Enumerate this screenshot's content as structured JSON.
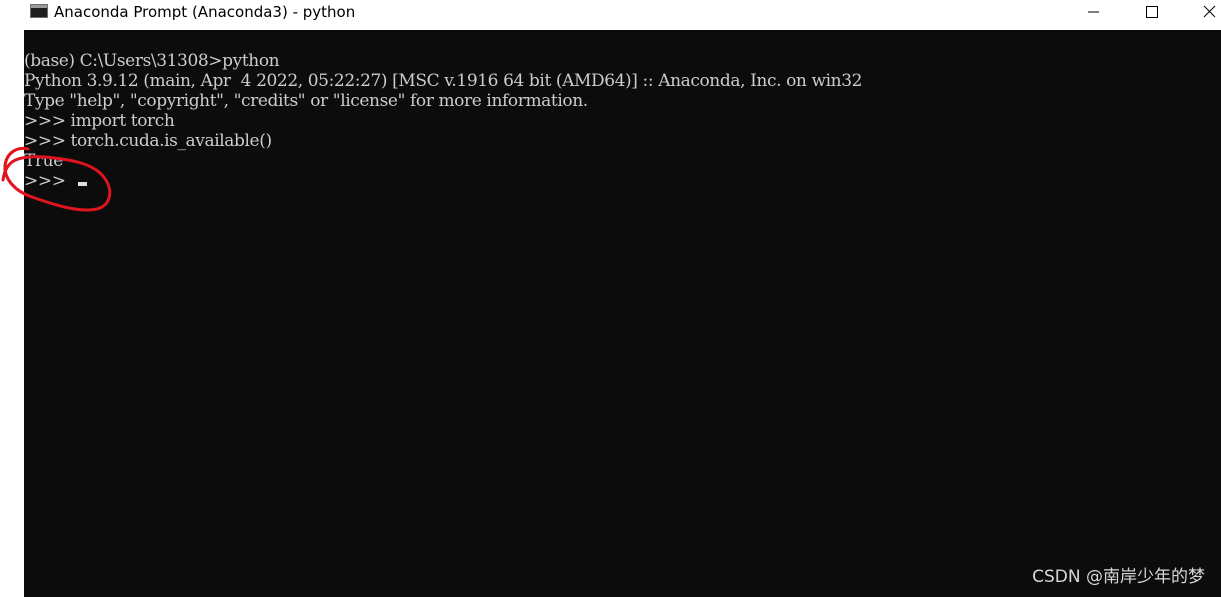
{
  "window": {
    "title": "Anaconda Prompt (Anaconda3) - python",
    "controls": {
      "minimize_icon": "minimize-icon",
      "maximize_icon": "maximize-icon",
      "close_icon": "close-icon"
    }
  },
  "console": {
    "background": "#0c0c0c",
    "foreground": "#cccccc",
    "lines": [
      "(base) C:\\Users\\31308>python",
      "Python 3.9.12 (main, Apr  4 2022, 05:22:27) [MSC v.1916 64 bit (AMD64)] :: Anaconda, Inc. on win32",
      "Type \"help\", \"copyright\", \"credits\" or \"license\" for more information.",
      ">>> import torch",
      ">>> torch.cuda.is_available()",
      "True"
    ],
    "active_prompt": ">>>"
  },
  "annotation": {
    "color": "#e0141e"
  },
  "watermark": "CSDN @南岸少年的梦"
}
